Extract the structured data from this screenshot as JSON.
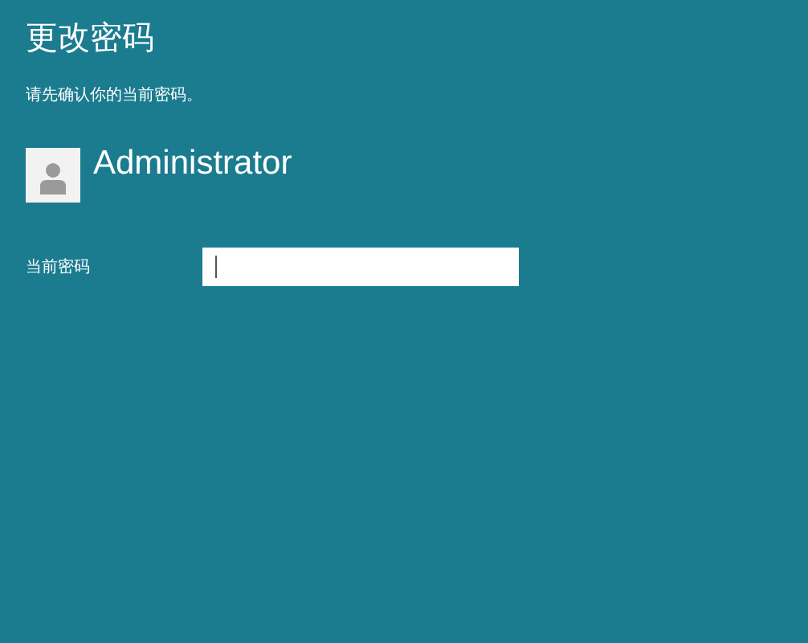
{
  "title": "更改密码",
  "subtitle": "请先确认你的当前密码。",
  "user": {
    "name": "Administrator"
  },
  "fields": [
    {
      "label": "当前密码",
      "focused": true
    }
  ]
}
